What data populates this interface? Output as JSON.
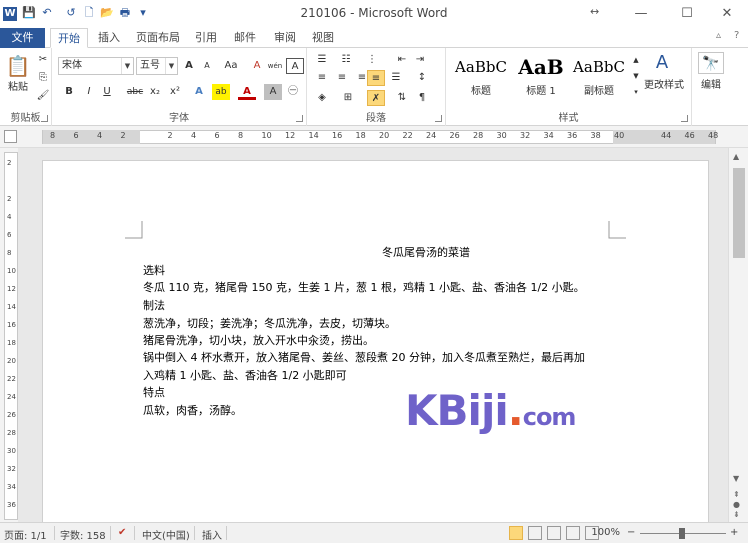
{
  "window": {
    "title": "210106 - Microsoft Word",
    "app_icon": "W",
    "resize_glyph": "↔",
    "controls": {
      "minimize": "—",
      "maximize": "☐",
      "close": "✕"
    },
    "help": "?"
  },
  "quick_access": {
    "save": "💾",
    "undo": "↶",
    "redo": "↺",
    "new": "🗋",
    "open": "📂",
    "print": "🖶",
    "more": "▾"
  },
  "tabs": [
    {
      "label": "文件"
    },
    {
      "label": "开始"
    },
    {
      "label": "插入"
    },
    {
      "label": "页面布局"
    },
    {
      "label": "引用"
    },
    {
      "label": "邮件"
    },
    {
      "label": "审阅"
    },
    {
      "label": "视图"
    }
  ],
  "ribbon": {
    "clipboard": {
      "label": "剪贴板",
      "paste": "粘贴"
    },
    "font": {
      "label": "字体",
      "font_name": "宋体",
      "font_size": "五号",
      "grow": "A",
      "shrink": "A",
      "change_case": "Aa",
      "bold": "B",
      "italic": "I",
      "underline": "U",
      "strike": "abc",
      "subscript": "x₂",
      "superscript": "x²",
      "text_effect": "A",
      "highlight": "ab",
      "font_color": "A",
      "char_shading": "A",
      "enclose": "㊀",
      "clear": "A",
      "phonetic": "wén",
      "border": "A"
    },
    "paragraph": {
      "label": "段落"
    },
    "styles": {
      "label": "样式",
      "items": [
        {
          "sample": "AaBbC",
          "name": "标题"
        },
        {
          "sample": "AaB",
          "name": "标题 1"
        },
        {
          "sample": "AaBbC",
          "name": "副标题"
        }
      ],
      "change": "更改样式"
    },
    "editing": {
      "label": "编辑"
    }
  },
  "ruler": {
    "ticks": [
      "8",
      "6",
      "4",
      "2",
      "",
      "2",
      "4",
      "6",
      "8",
      "10",
      "12",
      "14",
      "16",
      "18",
      "20",
      "22",
      "24",
      "26",
      "28",
      "30",
      "32",
      "34",
      "36",
      "38",
      "40",
      "",
      "44",
      "46",
      "48"
    ]
  },
  "vruler": {
    "ticks": [
      "2",
      "",
      "2",
      "4",
      "6",
      "8",
      "10",
      "12",
      "14",
      "16",
      "18",
      "20",
      "22",
      "24",
      "26",
      "28",
      "30",
      "32",
      "34",
      "36"
    ]
  },
  "document": {
    "title": "冬瓜尾骨汤的菜谱",
    "lines": [
      "选料",
      "冬瓜 110 克，猪尾骨 150 克，生姜 1 片，葱 1 根，鸡精 1 小匙、盐、香油各 1/2 小匙。",
      "制法",
      "葱洗净，切段；姜洗净；冬瓜洗净，去皮，切薄块。",
      "猪尾骨洗净，切小块，放入开水中汆烫，捞出。",
      "锅中倒入 4 杯水煮开，放入猪尾骨、姜丝、葱段煮 20 分钟，加入冬瓜煮至熟烂，最后再加",
      "入鸡精 1 小匙、盐、香油各 1/2 小匙即可",
      "特点",
      "瓜软，肉香，汤醇。"
    ]
  },
  "watermark": {
    "main": "KBiji",
    "dot": ".",
    "tld": "com"
  },
  "statusbar": {
    "page": "页面: 1/1",
    "words": "字数: 158",
    "language": "中文(中国)",
    "mode": "插入",
    "zoom": "100%",
    "zoom_minus": "−",
    "zoom_plus": "+"
  }
}
